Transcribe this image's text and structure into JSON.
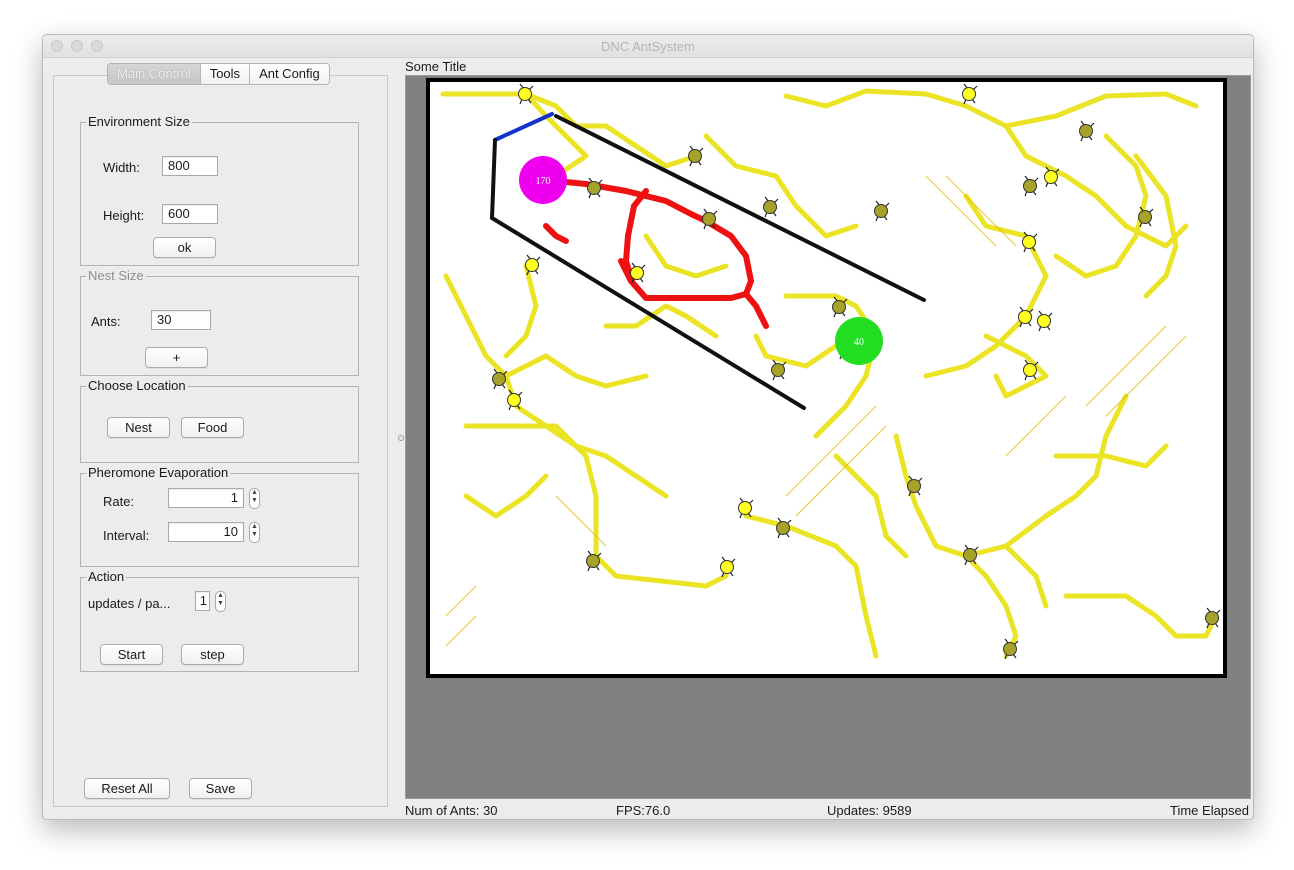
{
  "window": {
    "title": "DNC AntSystem"
  },
  "tabs": [
    "Main Control",
    "Tools",
    "Ant Config"
  ],
  "environment_size": {
    "legend": "Environment Size",
    "width_label": "Width:",
    "width_value": "800",
    "height_label": "Height:",
    "height_value": "600",
    "ok_label": "ok"
  },
  "nest_size": {
    "legend": "Nest Size",
    "ants_label": "Ants:",
    "ants_value": "30",
    "add_label": "+"
  },
  "choose_location": {
    "legend": "Choose Location",
    "nest_label": "Nest",
    "food_label": "Food"
  },
  "pheromone": {
    "legend": "Pheromone Evaporation",
    "rate_label": "Rate:",
    "rate_value": "1",
    "interval_label": "Interval:",
    "interval_value": "10"
  },
  "action": {
    "legend": "Action",
    "updates_label": "updates / pa...",
    "updates_value": "1",
    "start_label": "Start",
    "step_label": "step"
  },
  "bottom_buttons": {
    "reset_label": "Reset All",
    "save_label": "Save"
  },
  "panel_title": "Some Title",
  "simulation": {
    "nest_count": "170",
    "food_count": "40",
    "colors": {
      "nest": "#ee00ee",
      "food": "#22dd22",
      "trail": "#e8e000",
      "strong_trail": "#ee1111",
      "wall": "#111111",
      "wall_accent": "#1133cc",
      "ant_yellow": "#ffff22",
      "ant_olive": "#a7a32a",
      "background": "#808080"
    }
  },
  "status": {
    "ants": "Num of Ants: 30",
    "fps": "FPS:76.0",
    "updates": "Updates: 9589",
    "time": "Time Elapsed"
  }
}
